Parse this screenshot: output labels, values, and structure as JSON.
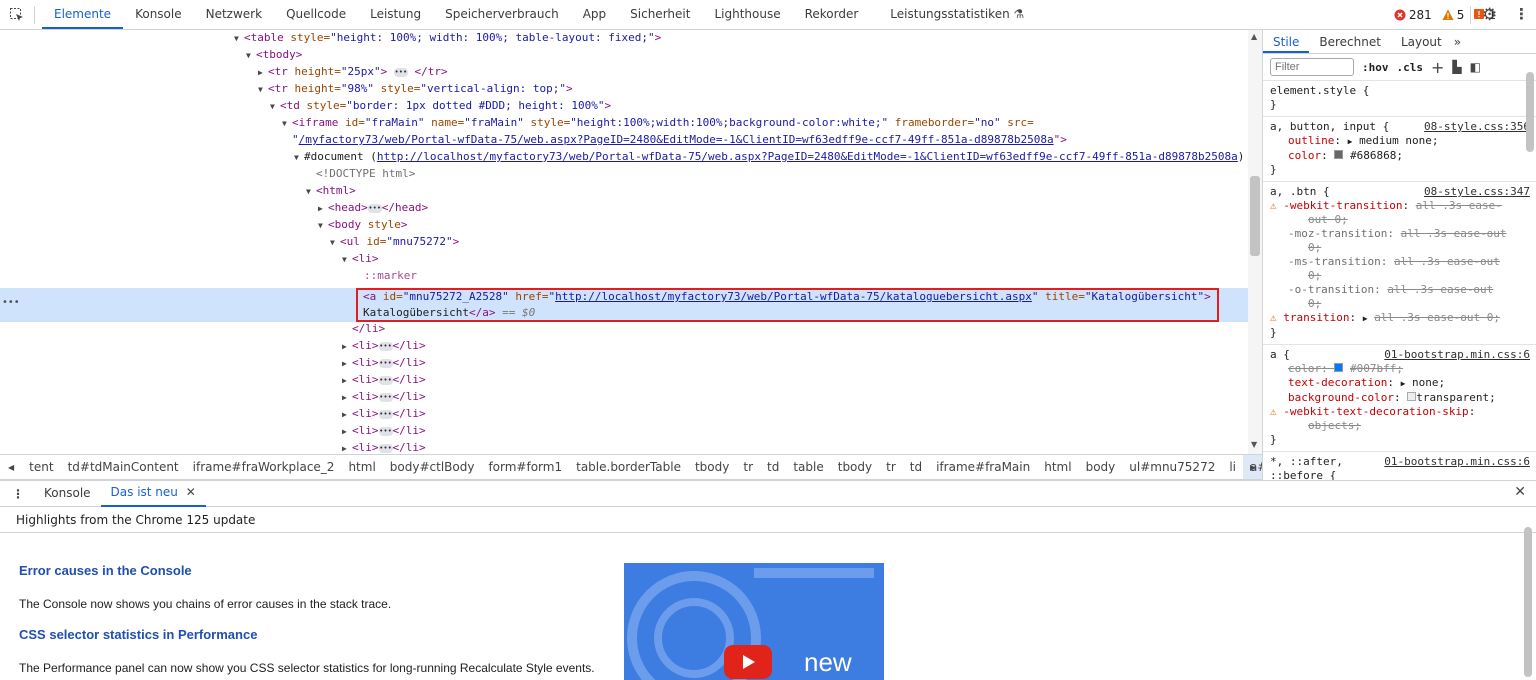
{
  "toolbar": {
    "tabs": [
      "Elemente",
      "Konsole",
      "Netzwerk",
      "Quellcode",
      "Leistung",
      "Speicherverbrauch",
      "App",
      "Sicherheit",
      "Lighthouse",
      "Rekorder",
      "Leistungsstatistiken"
    ],
    "active_tab": "Elemente",
    "errors": "281",
    "warnings": "5",
    "issues": "1"
  },
  "dom": {
    "l1": [
      "<table",
      " style=",
      "\"height: 100%; width: 100%; table-layout: fixed;\"",
      ">"
    ],
    "l2": "<tbody>",
    "l3": [
      "<tr",
      " height=",
      "\"25px\"",
      ">",
      "</tr>"
    ],
    "l4": [
      "<tr",
      " height=",
      "\"98%\"",
      " style=",
      "\"vertical-align: top;\"",
      ">"
    ],
    "l5": [
      "<td",
      " style=",
      "\"border: 1px dotted #DDD; height: 100%\"",
      ">"
    ],
    "l6": [
      "<iframe",
      " id=",
      "\"fraMain\"",
      " name=",
      "\"fraMain\"",
      " style=",
      "\"height:100%;width:100%;background-color:white;\"",
      " frameborder=",
      "\"no\"",
      " src="
    ],
    "l7": [
      "\"",
      "/myfactory73/web/Portal-wfData-75/web.aspx?PageID=2480&EditMode=-1&ClientID=wf63edff9e-ccf7-49ff-851a-d89878b2508a",
      "\">"
    ],
    "l8": [
      "#document (",
      "http://localhost/myfactory73/web/Portal-wfData-75/web.aspx?PageID=2480&EditMode=-1&ClientID=wf63edff9e-ccf7-49ff-851a-d89878b2508a",
      ")"
    ],
    "l9": "<!DOCTYPE html>",
    "l10": "<html>",
    "l11": [
      "<head>",
      "</head>"
    ],
    "l12": [
      "<body",
      " style",
      ">"
    ],
    "l13": [
      "<ul",
      " id=",
      "\"mnu75272\"",
      ">"
    ],
    "l14": "<li>",
    "l15": "::marker",
    "l16": [
      "<a",
      " id=",
      "\"mnu75272_A2528\"",
      " href=",
      "\"",
      "http://localhost/myfactory73/web/Portal-wfData-75/kataloguebersicht.aspx",
      "\"",
      " title=",
      "\"Katalogübersicht\"",
      ">"
    ],
    "l17": [
      "Katalogübersicht",
      "</a>",
      " == $0"
    ],
    "l18": "</li>",
    "li_open": "<li>",
    "li_close": "</li>"
  },
  "breadcrumbs": [
    "tent",
    "td#tdMainContent",
    "iframe#fraWorkplace_2",
    "html",
    "body#ctlBody",
    "form#form1",
    "table.borderTable",
    "tbody",
    "tr",
    "td",
    "table",
    "tbody",
    "tr",
    "td",
    "iframe#fraMain",
    "html",
    "body",
    "ul#mnu75272",
    "li",
    "a#mnu75272_A2528"
  ],
  "styles": {
    "tabs": [
      "Stile",
      "Berechnet",
      "Layout"
    ],
    "filter_placeholder": "Filter",
    "hov": ":hov",
    "cls": ".cls",
    "rules": {
      "r0": {
        "sel": "element.style {",
        "close": "}"
      },
      "r1": {
        "sel": "a, button, input {",
        "src": "08-style.css:356",
        "d": [
          [
            "outline",
            "medium none;"
          ],
          [
            "color",
            "#686868;"
          ]
        ],
        "close": "}"
      },
      "r2": {
        "sel": "a, .btn {",
        "src": "08-style.css:347",
        "d": [
          [
            "-webkit-transition",
            "all .3s ease-",
            "out 0;"
          ],
          [
            "-moz-transition",
            "all .3s ease-out",
            "0;"
          ],
          [
            "-ms-transition",
            "all .3s ease-out",
            "0;"
          ],
          [
            "-o-transition",
            "all .3s ease-out",
            "0;"
          ],
          [
            "transition",
            "all .3s ease-out 0;"
          ]
        ],
        "close": "}"
      },
      "r3": {
        "sel": "a {",
        "src": "01-bootstrap.min.css:6",
        "d": [
          [
            "color",
            "#007bff;"
          ],
          [
            "text-decoration",
            "none;"
          ],
          [
            "background-color",
            "transparent;"
          ],
          [
            "-webkit-text-decoration-skip",
            "objects;"
          ]
        ],
        "close": "}"
      },
      "r4": {
        "sel": "*, ::after,",
        "sel2": "::before {",
        "src": "01-bootstrap.min.css:6"
      }
    }
  },
  "drawer": {
    "tabs": [
      "Konsole",
      "Das ist neu"
    ],
    "subtitle": "Highlights from the Chrome 125 update",
    "h1": "Error causes in the Console",
    "p1": "The Console now shows you chains of error causes in the stack trace.",
    "h2": "CSS selector statistics in Performance",
    "p2": "The Performance panel can now show you CSS selector statistics for long-running Recalculate Style events.",
    "promo_text": "new"
  },
  "colors": {
    "accent": "#1a5fd1",
    "highlight": "#e01e1e",
    "selected_row": "#cfe3fc"
  }
}
